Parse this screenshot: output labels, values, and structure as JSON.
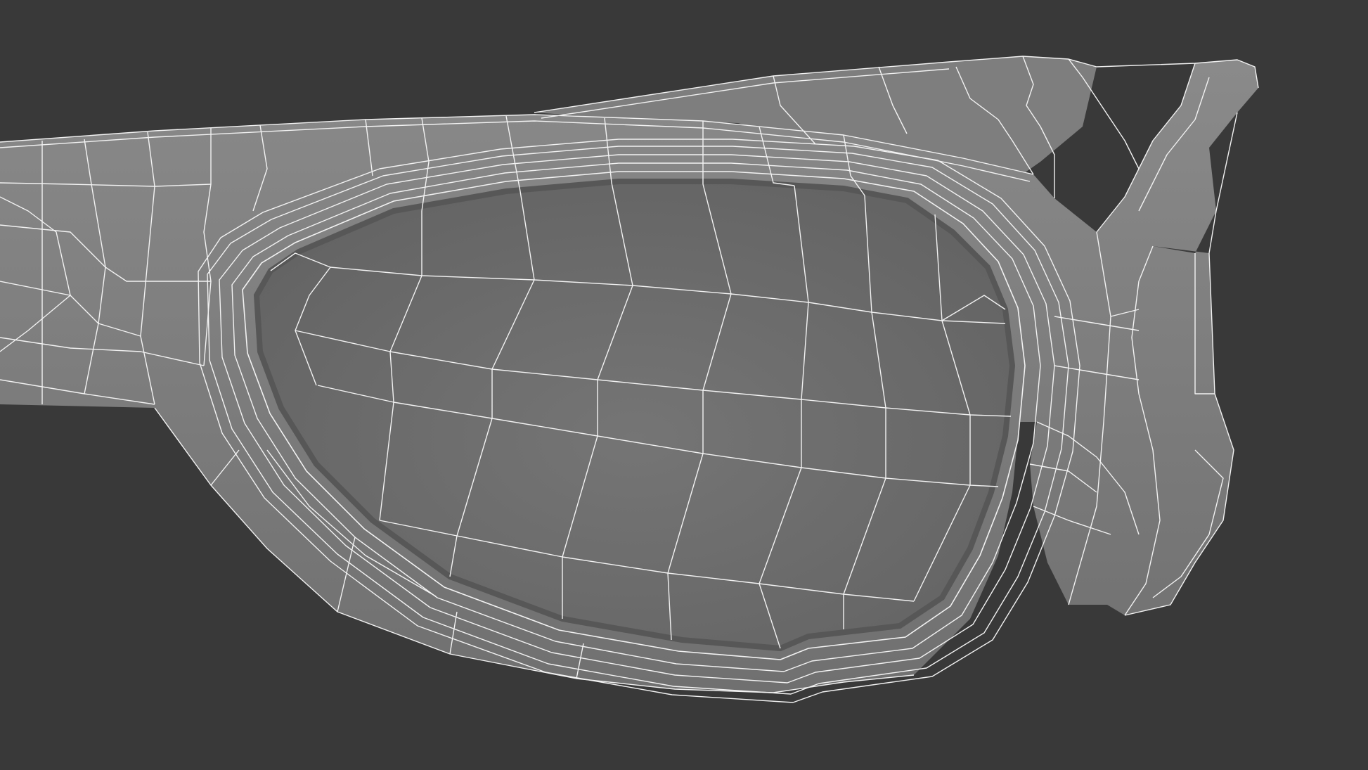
{
  "scene": {
    "subject": "wireframe-sunglasses-render",
    "colors": {
      "background": "#393939",
      "frame": "#7c7c7c",
      "frame_light": "#8a8a8a",
      "frame_dark": "#6a6a6a",
      "lens": "#6f6f6f",
      "lens_edge": "#5a5a5a",
      "wire": "#f2f2f2"
    }
  }
}
